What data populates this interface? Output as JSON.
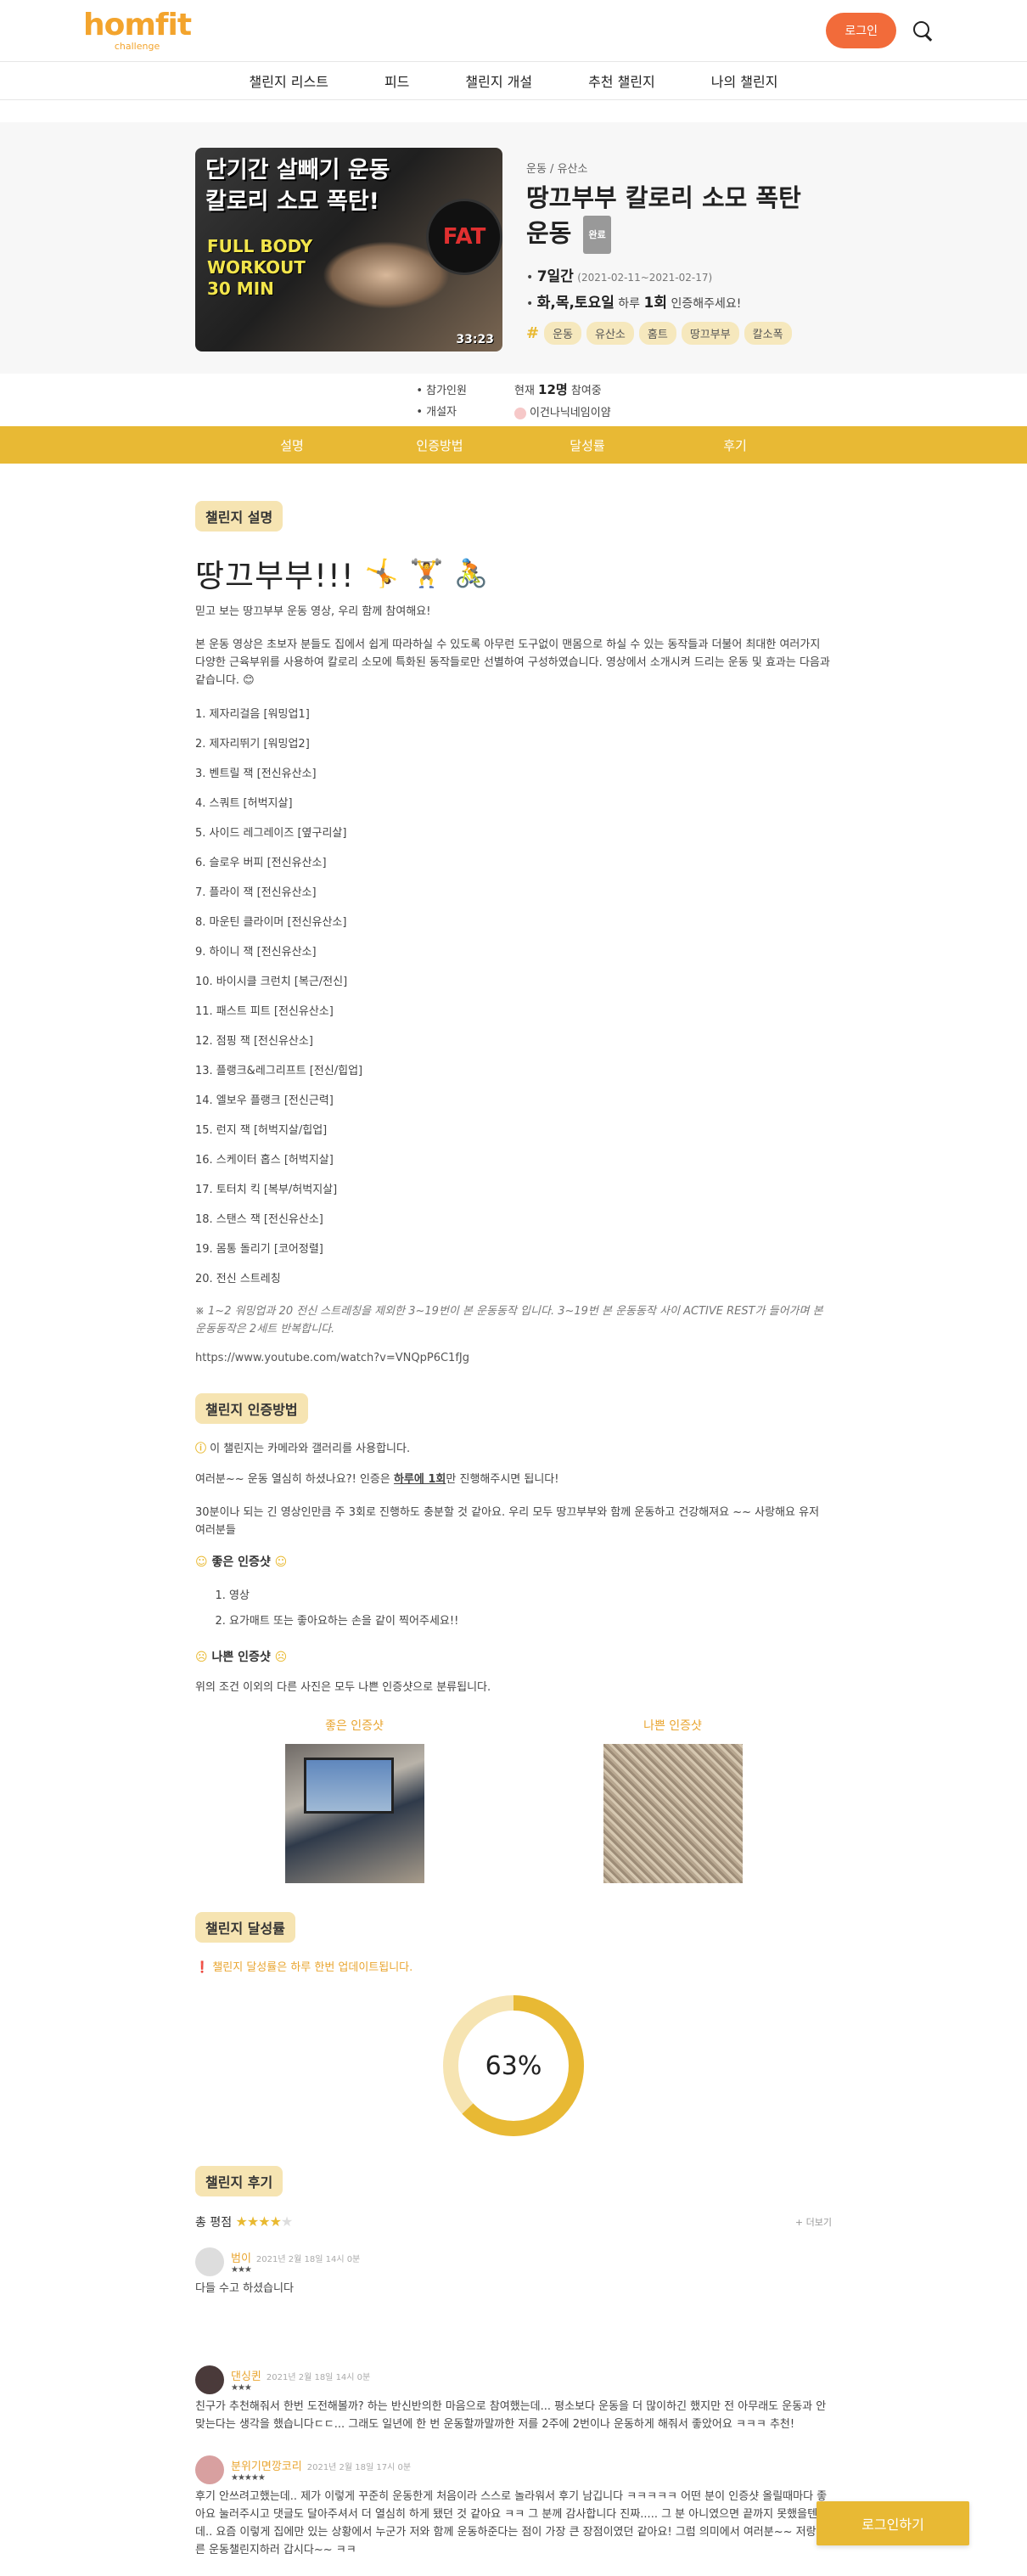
{
  "header": {
    "logo_main": "homfit",
    "logo_sub": "challenge",
    "login_label": "로그인"
  },
  "nav": [
    "챌린지 리스트",
    "피드",
    "챌린지 개설",
    "추천 챌린지",
    "나의 챌린지"
  ],
  "challenge": {
    "thumb_title_1": "단기간 살빼기 운동",
    "thumb_title_2": "칼로리 소모 폭탄!",
    "thumb_sub_1": "FULL BODY",
    "thumb_sub_2": "WORKOUT",
    "thumb_sub_3": "30 MIN",
    "thumb_bomb": "FAT",
    "thumb_time": "33:23",
    "category": "운동",
    "sub_category": "유산소",
    "title": "땅끄부부 칼로리 소모 폭탄 운동",
    "status": "완료",
    "period_bold": "7일간",
    "period_range": "(2021-02-11~2021-02-17)",
    "days_bold": "화,목,토요일",
    "days_mid": "하루",
    "times_bold": "1회",
    "days_tail": "인증해주세요!",
    "tags": [
      "운동",
      "유산소",
      "홈트",
      "땅끄부부",
      "칼소폭"
    ]
  },
  "stats": {
    "participants_label": "참가인원",
    "creator_label": "개설자",
    "participants_prefix": "현재",
    "participants_count": "12명",
    "participants_suffix": "참여중",
    "creator_name": "이건나닉네임이얌"
  },
  "tabs": [
    "설명",
    "인증방법",
    "달성률",
    "후기"
  ],
  "description": {
    "badge": "챌린지 설명",
    "big_title": "땅끄부부!!!",
    "intro": "믿고 보는 땅끄부부 운동 영상, 우리 함께 참여해요!",
    "paragraph": "본 운동 영상은 초보자 분들도 집에서 쉽게 따라하실 수 있도록 아무런 도구없이 맨몸으로 하실 수 있는 동작들과 더불어 최대한 여러가지 다양한 근육부위를 사용하여 칼로리 소모에 특화된 동작들로만 선별하여 구성하였습니다. 영상에서 소개시켜 드리는 운동 및 효과는 다음과 같습니다. 😊",
    "moves": [
      "1. 제자리걸음 [워밍업1]",
      "2. 제자리뛰기 [워밍업2]",
      "3. 벤트릴 잭 [전신유산소]",
      "4. 스쿼트 [허벅지살]",
      "5. 사이드 레그레이즈 [옆구리살]",
      "6. 슬로우 버피 [전신유산소]",
      "7. 플라이 잭 [전신유산소]",
      "8. 마운틴 클라이머 [전신유산소]",
      "9. 하이니 잭 [전신유산소]",
      "10. 바이시클 크런치 [복근/전신]",
      "11. 패스트 피트 [전신유산소]",
      "12. 점핑 잭 [전신유산소]",
      "13. 플랭크&레그리프트 [전신/힙업]",
      "14. 엘보우 플랭크 [전신근력]",
      "15. 런지 잭 [허벅지살/힙업]",
      "16. 스케이터 홉스 [허벅지살]",
      "17. 토터치 킥 [복부/허벅지살]",
      "18. 스탠스 잭 [전신유산소]",
      "19. 몸통 돌리기 [코어정렬]",
      "20. 전신 스트레칭"
    ],
    "note": "※ 1~2 워밍업과 20 전신 스트레칭을 제외한 3~19번이 본 운동동작 입니다. 3~19번 본 운동동작 사이 ACTIVE REST가 들어가며 본 운동동작은 2세트 반복합니다.",
    "url": "https://www.youtube.com/watch?v=VNQpP6C1fJg"
  },
  "verify": {
    "badge": "챌린지 인증방법",
    "notice": "이 챌린지는 카메라와 갤러리를 사용합니다.",
    "p1_prefix": "여러분~~ 운동 열심히 하셨나요?! 인증은",
    "p1_bold": "하루에 1회",
    "p1_suffix": "만 진행해주시면 됩니다!",
    "p2": "30분이나 되는 긴 영상인만큼 주 3회로 진행하도 충분할 것 같아요. 우리 모두 땅끄부부와 함께 운동하고 건강해져요 ~~ 사랑해요 유저 여러분들",
    "good_head": "좋은 인증샷",
    "good_items": [
      "영상",
      "요가매트 또는 좋아요하는 손을 같이 찍어주세요!!"
    ],
    "bad_head": "나쁜 인증샷",
    "bad_desc": "위의 조건 이외의 다른 사진은 모두 나쁜 인증샷으로 분류됩니다.",
    "good_label": "좋은 인증샷",
    "bad_label": "나쁜 인증샷"
  },
  "achievement": {
    "badge": "챌린지 달성률",
    "notice": "챌린지 달성률은 하루 한번 업데이트됩니다.",
    "percent": 63,
    "percent_label": "63%",
    "colors": {
      "track": "#f6e4b2",
      "fill": "#e8b934"
    }
  },
  "reviews": {
    "badge": "챌린지 후기",
    "score_label": "총 평점",
    "score_stars": 4,
    "more_label": "+ 더보기",
    "items": [
      {
        "name": "범이",
        "date": "2021년 2월 18일 14시 0분",
        "stars": 3,
        "body": "다들 수고 하셨습니다"
      },
      {
        "name": "댄싱퀸",
        "date": "2021년 2월 18일 14시 0분",
        "stars": 3,
        "body": "친구가 추천해줘서 한번 도전해볼까? 하는 반신반의한 마음으로 참여했는데... 평소보다 운동을 더 많이하긴 했지만 전 아무래도 운동과 안맞는다는 생각을 했습니다ㄷㄷ... 그래도 일년에 한 번 운동할까말까한 저를 2주에 2번이나 운동하게 해줘서 좋았어요 ㅋㅋㅋ 추천!"
      },
      {
        "name": "분위기면깡코리",
        "date": "2021년 2월 18일 17시 0분",
        "stars": 5,
        "body": "후기 안쓰려고했는데.. 제가 이렇게 꾸준히 운동한게 처음이라 스스로 놀라워서 후기 남깁니다 ㅋㅋㅋㅋㅋ 어떤 분이 인증샷 올릴때마다 좋아요 눌러주시고 댓글도 달아주셔서 더 열심히 하게 됐던 것 같아요 ㅋㅋ 그 분께 감사합니다 진짜..... 그 분 아니였으면 끝까지 못했을텐데.. 요즘 이렇게 집에만 있는 상황에서 누군가 저와 함께 운동하준다는 점이 가장 큰 장점이였던 같아요! 그럼 의미에서 여러분~~ 저랑 다른 운동챌린지하러 갑시다~~ ㅋㅋ"
      }
    ]
  },
  "floating_login_label": "로그인하기"
}
